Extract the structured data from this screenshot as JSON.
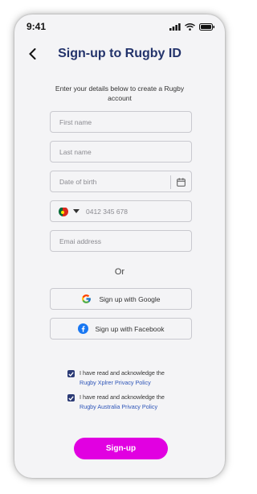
{
  "status_bar": {
    "time": "9:41",
    "icons": [
      "signal-icon",
      "wifi-icon",
      "battery-icon"
    ]
  },
  "header": {
    "back_icon": "chevron-left-icon",
    "title": "Sign-up to Rugby ID"
  },
  "intro": "Enter your details below to create a Rugby account",
  "form": {
    "first_name_placeholder": "First name",
    "last_name_placeholder": "Last name",
    "dob_placeholder": "Date of birth",
    "phone_placeholder": "0412 345 678",
    "email_placeholder": "Emai address"
  },
  "or_label": "Or",
  "social": {
    "google_label": "Sign up with Google",
    "facebook_label": "Sign up with Facebook"
  },
  "consents": [
    {
      "text": "I have read and acknowledge the",
      "link": "Rugby Xplrer Privacy Policy",
      "checked": true
    },
    {
      "text": "I have read and acknowledge the",
      "link": "Rugby Australia Privacy Policy",
      "checked": true
    }
  ],
  "signup_label": "Sign-up",
  "colors": {
    "title": "#23336b",
    "accent": "#e100e1",
    "checkbox": "#2b3a75",
    "link": "#2f56b8",
    "facebook": "#1877f2"
  }
}
